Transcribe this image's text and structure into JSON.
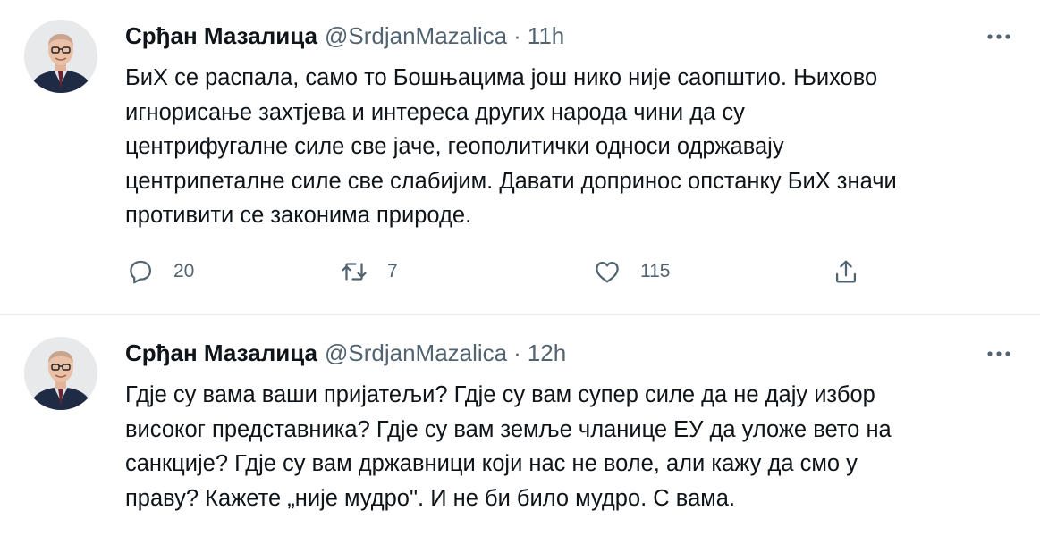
{
  "tweets": [
    {
      "author_name": "Срђан Мазалица",
      "handle": "@SrdjanMazalica",
      "separator": "·",
      "time": "11h",
      "text_lines": [
        "БиХ се распала, само то Бошњацима још нико није саопштио. Њихово",
        "игнорисање захтјева и интереса других народа чини да су",
        "центрифугалне силе све јаче, геополитички односи одржавају",
        "центрипеталне силе све слабијим. Давати допринос опстанку БиХ значи",
        "противити се законима природе."
      ],
      "replies": "20",
      "retweets": "7",
      "likes": "115"
    },
    {
      "author_name": "Срђан Мазалица",
      "handle": "@SrdjanMazalica",
      "separator": "·",
      "time": "12h",
      "text_lines": [
        "Гдје су вама ваши пријатељи? Гдје су вам супер силе да не дају избор",
        "високог представника? Гдје су вам земље чланице ЕУ да уложе вето на",
        "санкције? Гдје су вам државници који нас не воле, али кажу да смо у",
        "праву? Кажете „није мудро\". И не би било мудро. С вама."
      ]
    }
  ],
  "icons": {
    "more": "more-horizontal-icon",
    "reply": "reply-bubble-icon",
    "retweet": "retweet-icon",
    "like": "heart-icon",
    "share": "share-icon"
  },
  "colors": {
    "text_primary": "#0f1419",
    "text_secondary": "#536471",
    "divider": "#e6ecf0",
    "background": "#ffffff"
  }
}
